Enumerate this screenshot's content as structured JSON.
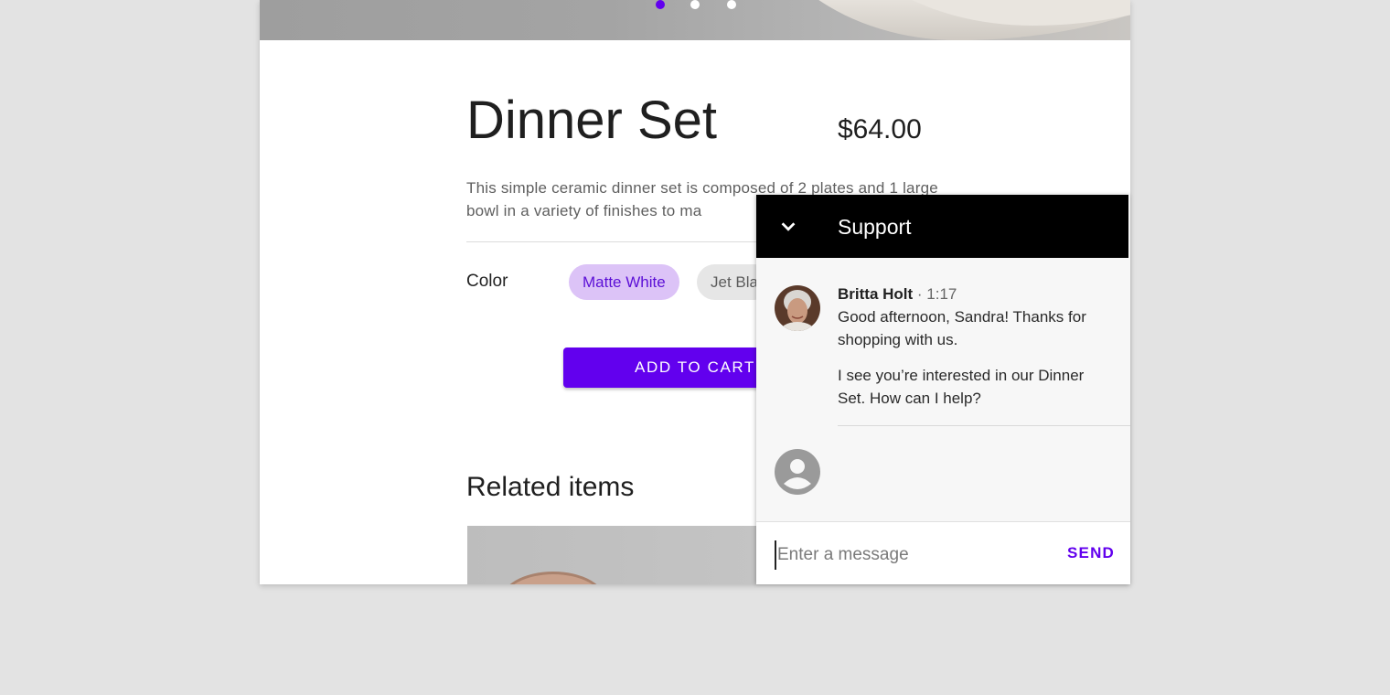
{
  "hero": {
    "carousel_dots": [
      {
        "active": true
      },
      {
        "active": false
      },
      {
        "active": false
      }
    ]
  },
  "product": {
    "title": "Dinner Set",
    "price": "$64.00",
    "description": "This simple ceramic dinner set is composed of 2 plates and 1 large bowl in a variety of finishes to ma",
    "color_label": "Color",
    "color_options": [
      "Matte White",
      "Jet Bla"
    ],
    "selected_color": "Matte White",
    "add_to_cart_label": "ADD TO CART",
    "related_heading": "Related items"
  },
  "support": {
    "title": "Support",
    "collapse_icon": "chevron-down-icon",
    "message": {
      "sender": "Britta Holt",
      "separator": " · ",
      "time": "1:17",
      "lines": [
        "Good afternoon, Sandra! Thanks for shopping with us.",
        "I see you’re interested in our Dinner Set. How can I help?"
      ]
    },
    "user_avatar_icon": "account-circle-icon",
    "input_placeholder": "Enter a message",
    "send_label": "SEND"
  },
  "colors": {
    "accent": "#6200ee",
    "chip_selected_bg": "#dcc3f7",
    "page_bg": "#e3e3e3",
    "header_bg": "#000000"
  }
}
